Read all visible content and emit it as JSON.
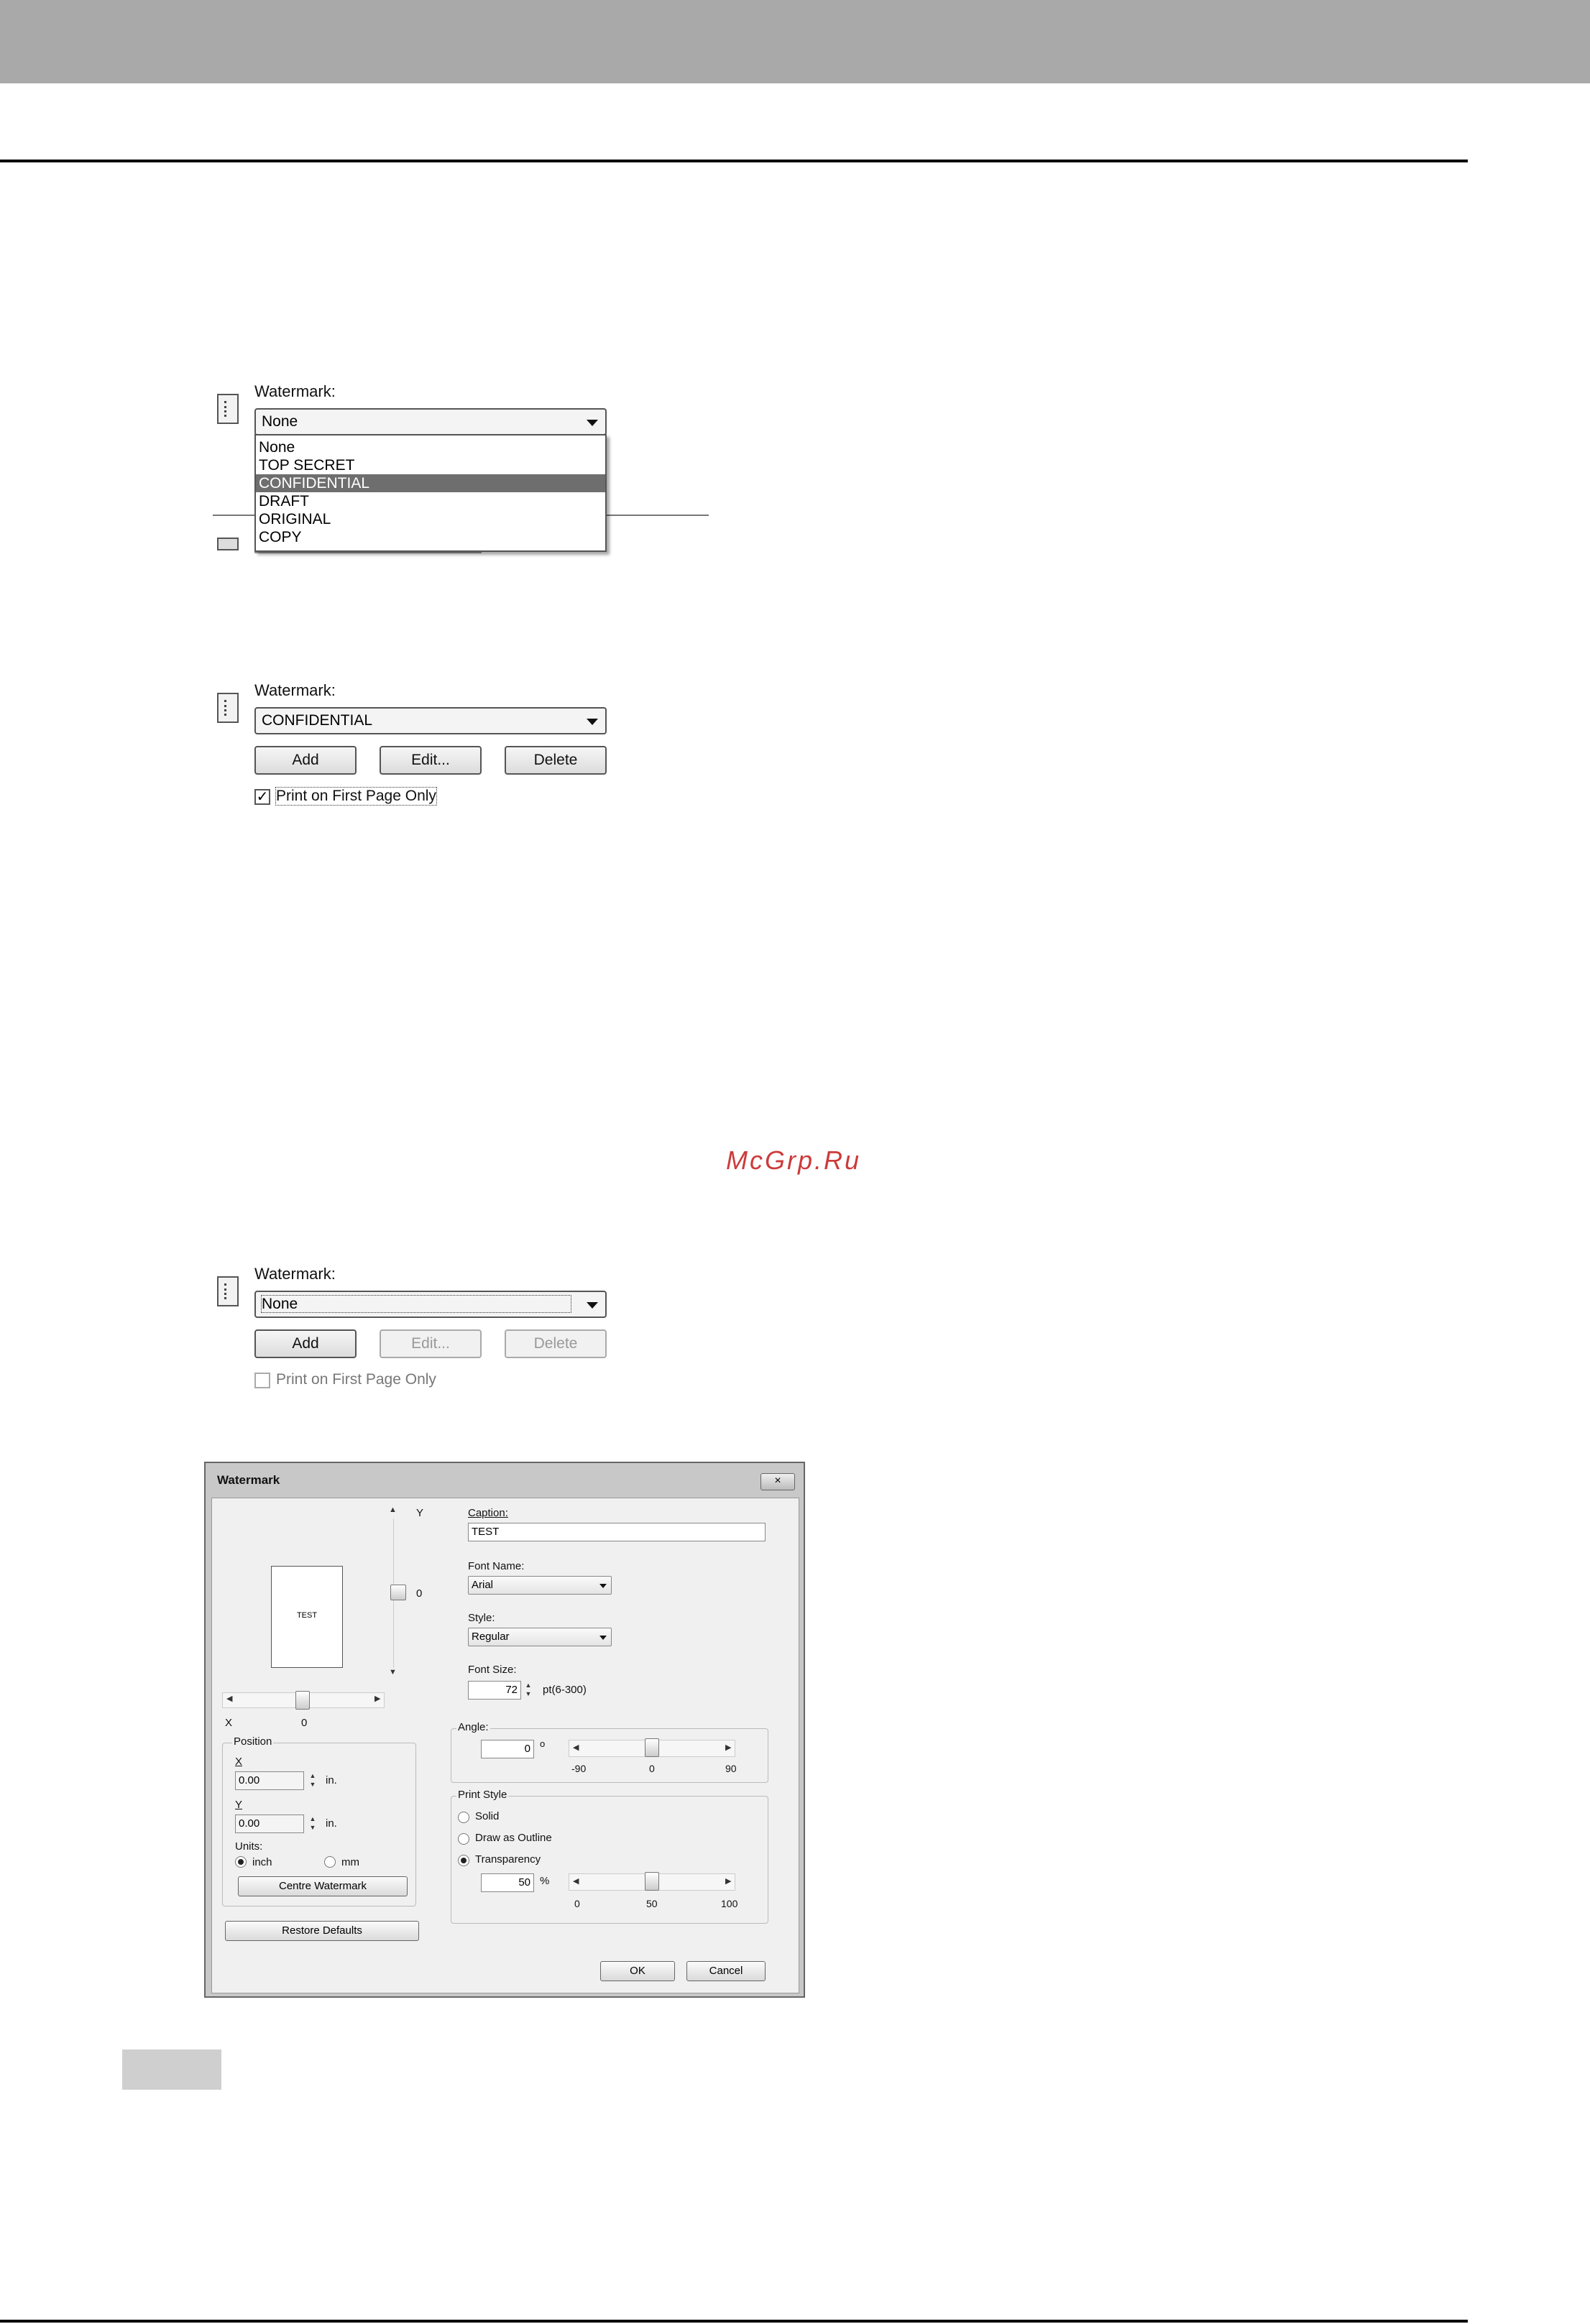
{
  "page": {
    "watermark_brand": "McGrp.Ru"
  },
  "panel1": {
    "label": "Watermark:",
    "selected": "None",
    "options": [
      "None",
      "TOP SECRET",
      "CONFIDENTIAL",
      "DRAFT",
      "ORIGINAL",
      "COPY"
    ],
    "highlighted": "CONFIDENTIAL"
  },
  "panel2": {
    "label": "Watermark:",
    "selected": "CONFIDENTIAL",
    "add_label": "Add",
    "edit_label": "Edit...",
    "delete_label": "Delete",
    "first_page_label": "Print on First Page Only",
    "first_page_checked": true
  },
  "panel3": {
    "label": "Watermark:",
    "selected": "None",
    "add_label": "Add",
    "edit_label": "Edit...",
    "delete_label": "Delete",
    "first_page_label": "Print on First Page Only",
    "first_page_checked": false
  },
  "dialog": {
    "title": "Watermark",
    "close_label": "×",
    "preview_text": "TEST",
    "y_label": "Y",
    "y_value": "0",
    "x_label": "X",
    "x_value": "0",
    "position_label": "Position",
    "pos_x_label": "X",
    "pos_x_value": "0.00",
    "pos_y_label": "Y",
    "pos_y_value": "0.00",
    "unit_in": "in.",
    "units_label": "Units:",
    "unit_inch": "inch",
    "unit_mm": "mm",
    "centre_label": "Centre Watermark",
    "restore_label": "Restore Defaults",
    "caption_label": "Caption:",
    "caption_value": "TEST",
    "font_name_label": "Font Name:",
    "font_name_value": "Arial",
    "style_label": "Style:",
    "style_value": "Regular",
    "font_size_label": "Font Size:",
    "font_size_value": "72",
    "font_size_range": "pt(6-300)",
    "angle_label": "Angle:",
    "angle_value": "0",
    "angle_unit": "o",
    "angle_ticks": [
      "-90",
      "0",
      "90"
    ],
    "print_style_label": "Print Style",
    "style_solid": "Solid",
    "style_outline": "Draw as Outline",
    "style_transparency": "Transparency",
    "transparency_value": "50",
    "transparency_unit": "%",
    "transparency_ticks": [
      "0",
      "50",
      "100"
    ],
    "ok_label": "OK",
    "cancel_label": "Cancel"
  }
}
